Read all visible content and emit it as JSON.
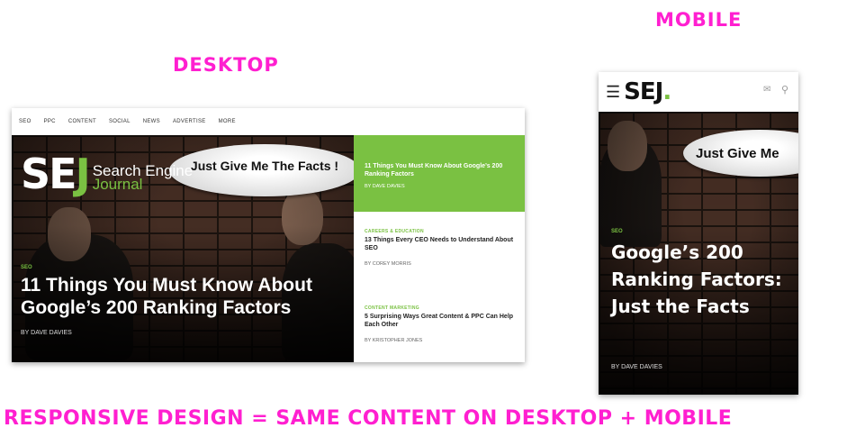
{
  "labels": {
    "desktop": "DESKTOP",
    "mobile": "MOBILE",
    "caption": "RESPONSIVE DESIGN = SAME CONTENT ON DESKTOP + MOBILE"
  },
  "desktop": {
    "nav": [
      "SEO",
      "PPC",
      "CONTENT",
      "SOCIAL",
      "NEWS",
      "ADVERTISE",
      "MORE"
    ],
    "logo": {
      "letters_se": "SE",
      "letters_j": "J",
      "name_line1": "Search Engine",
      "name_line2": "Journal"
    },
    "bubble": "Just Give Me The Facts !",
    "hero": {
      "tag": "SEO",
      "title": "11 Things You Must Know About Google’s 200 Ranking Factors",
      "byline": "BY DAVE DAVIES"
    },
    "sidebar": [
      {
        "category": "",
        "title": "11 Things You Must Know About Google’s 200 Ranking Factors",
        "byline": "BY DAVE DAVIES"
      },
      {
        "category": "CAREERS & EDUCATION",
        "title": "13 Things Every CEO Needs to Understand About SEO",
        "byline": "BY COREY MORRIS"
      },
      {
        "category": "CONTENT MARKETING",
        "title": "5 Surprising Ways Great Content & PPC Can Help Each Other",
        "byline": "BY KRISTOPHER JONES"
      }
    ]
  },
  "mobile": {
    "logo": {
      "letters": "SEJ",
      "dot": "."
    },
    "menu_icon": "hamburger-icon",
    "bubble": "Just Give Me",
    "hero": {
      "tag": "SEO",
      "title": "Google’s 200 Ranking Factors: Just the Facts",
      "byline": "BY DAVE DAVIES"
    }
  },
  "colors": {
    "magenta": "#ff1fd0",
    "sej_green": "#7ac142"
  }
}
